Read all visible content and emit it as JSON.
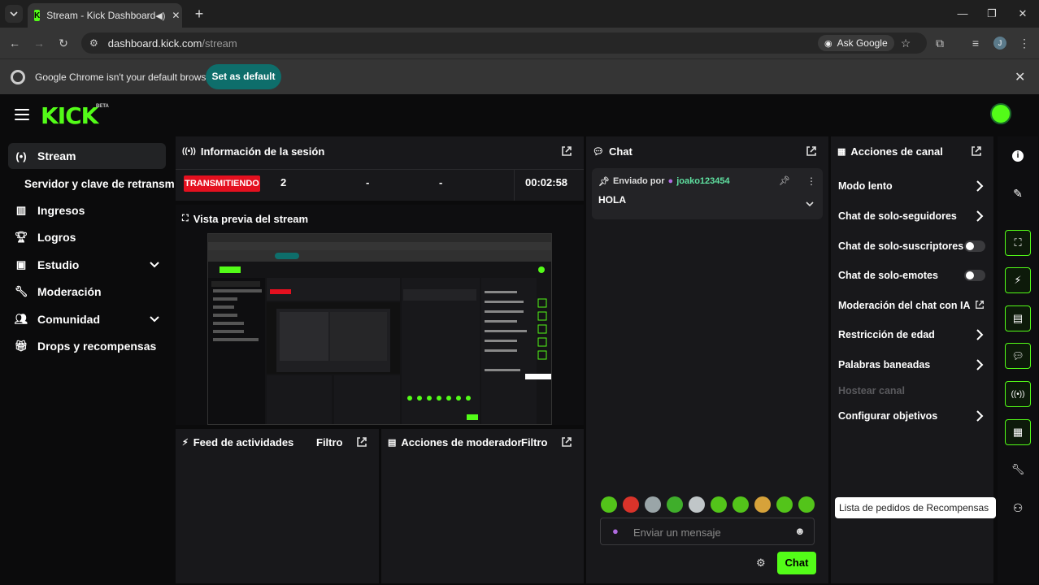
{
  "browser": {
    "tab_title": "Stream - Kick Dashboard",
    "url_host": "dashboard.kick.com",
    "url_path": "/stream",
    "ask_google": "Ask Google",
    "avatar_letter": "J",
    "infobar_message": "Google Chrome isn't your default browser",
    "set_default": "Set as default"
  },
  "kick": {
    "logo": "KICK",
    "beta": "BETA"
  },
  "sidebar": {
    "items": [
      {
        "label": "Stream",
        "icon": "broadcast-icon"
      },
      {
        "label": "Servidor y clave de retransm"
      },
      {
        "label": "Ingresos",
        "icon": "chart-icon"
      },
      {
        "label": "Logros",
        "icon": "trophy-icon"
      },
      {
        "label": "Estudio",
        "icon": "studio-icon"
      },
      {
        "label": "Moderación",
        "icon": "wrench-icon"
      },
      {
        "label": "Comunidad",
        "icon": "people-icon"
      },
      {
        "label": "Drops y recompensas",
        "icon": "gift-icon"
      }
    ]
  },
  "session": {
    "title": "Información de la sesión",
    "status": "TRANSMITIENDO",
    "stats": [
      "2",
      "-",
      "-",
      "00:02:58"
    ]
  },
  "preview": {
    "title": "Vista previa del stream"
  },
  "feed": {
    "title": "Feed de actividades",
    "filter": "Filtro"
  },
  "modactions": {
    "title": "Acciones de moderador",
    "filter": "Filtro"
  },
  "chat": {
    "title": "Chat",
    "pinned_prefix": "Enviado por",
    "pinned_user": "joako123454",
    "pinned_message": "HOLA",
    "input_placeholder": "Enviar un mensaje",
    "send_label": "Chat"
  },
  "actions": {
    "title": "Acciones de canal",
    "items": [
      {
        "label": "Modo lento",
        "control": "chevron"
      },
      {
        "label": "Chat de solo-seguidores",
        "control": "chevron"
      },
      {
        "label": "Chat de solo-suscriptores",
        "control": "toggle",
        "on": false
      },
      {
        "label": "Chat de solo-emotes",
        "control": "toggle",
        "on": false
      },
      {
        "label": "Moderación del chat con IA",
        "control": "external"
      },
      {
        "label": "Restricción de edad",
        "control": "chevron"
      },
      {
        "label": "Palabras baneadas",
        "control": "chevron"
      },
      {
        "label": "Hostear canal",
        "control": "none",
        "disabled": true
      },
      {
        "label": "Configurar objetivos",
        "control": "chevron"
      }
    ]
  },
  "rail": {
    "tooltip": "Lista de pedidos de Recompensas"
  },
  "colors": {
    "accent": "#53fc18",
    "live": "#e4101f",
    "panel": "#18181b"
  }
}
